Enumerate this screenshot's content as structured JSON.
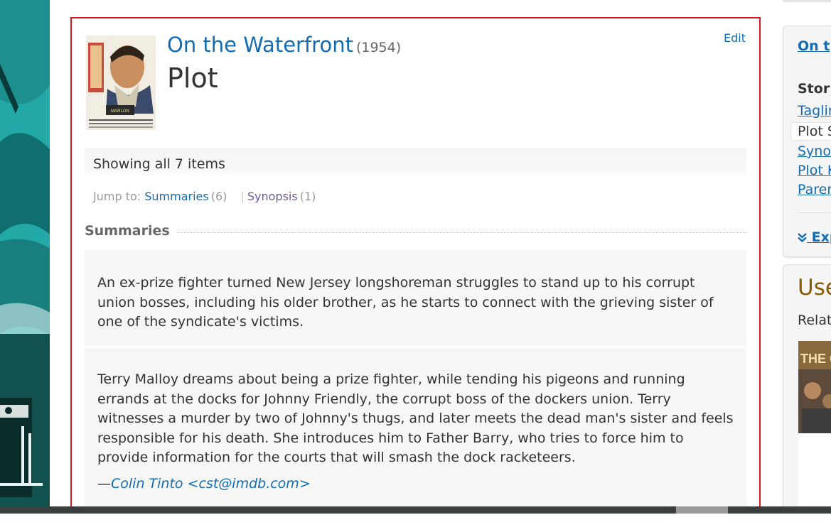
{
  "movie": {
    "title": "On the Waterfront",
    "year": "(1954)"
  },
  "page": {
    "heading": "Plot",
    "edit_label": "Edit",
    "showing_text": "Showing all 7 items"
  },
  "jump": {
    "label": "Jump to:",
    "items": [
      {
        "label": "Summaries",
        "count": "(6)"
      },
      {
        "label": "Synopsis",
        "count": "(1)"
      }
    ],
    "separator": "|"
  },
  "section": {
    "heading": "Summaries"
  },
  "summaries": [
    {
      "text": "An ex-prize fighter turned New Jersey longshoreman struggles to stand up to his corrupt union bosses, including his older brother, as he starts to connect with the grieving sister of one of the syndicate's victims."
    },
    {
      "text": "Terry Malloy dreams about being a prize fighter, while tending his pigeons and running errands at the docks for Johnny Friendly, the corrupt boss of the dockers union. Terry witnesses a murder by two of Johnny's thugs, and later meets the dead man's sister and feels responsible for his death. She introduces him to Father Barry, who tries to force him to provide information for the courts that will smash the dock racketeers.",
      "author_dash": "—",
      "author": "Colin Tinto <cst@imdb.com>"
    }
  ],
  "sidebar": {
    "title": "On t",
    "section": "Stor",
    "links": [
      "Taglir",
      "Plot S",
      "Syno",
      "Plot K",
      "Parer"
    ],
    "active_index": 1,
    "expand_icon": "double-chevron-down-icon",
    "expand_label": "Exp"
  },
  "sidebar2": {
    "title": "Use",
    "subtitle": "Relat",
    "thumb_text": "THE O"
  },
  "colors": {
    "link": "#136cb2",
    "visited": "#70579d",
    "highlight_border": "#d8181e",
    "teal": "#22a9a7"
  }
}
